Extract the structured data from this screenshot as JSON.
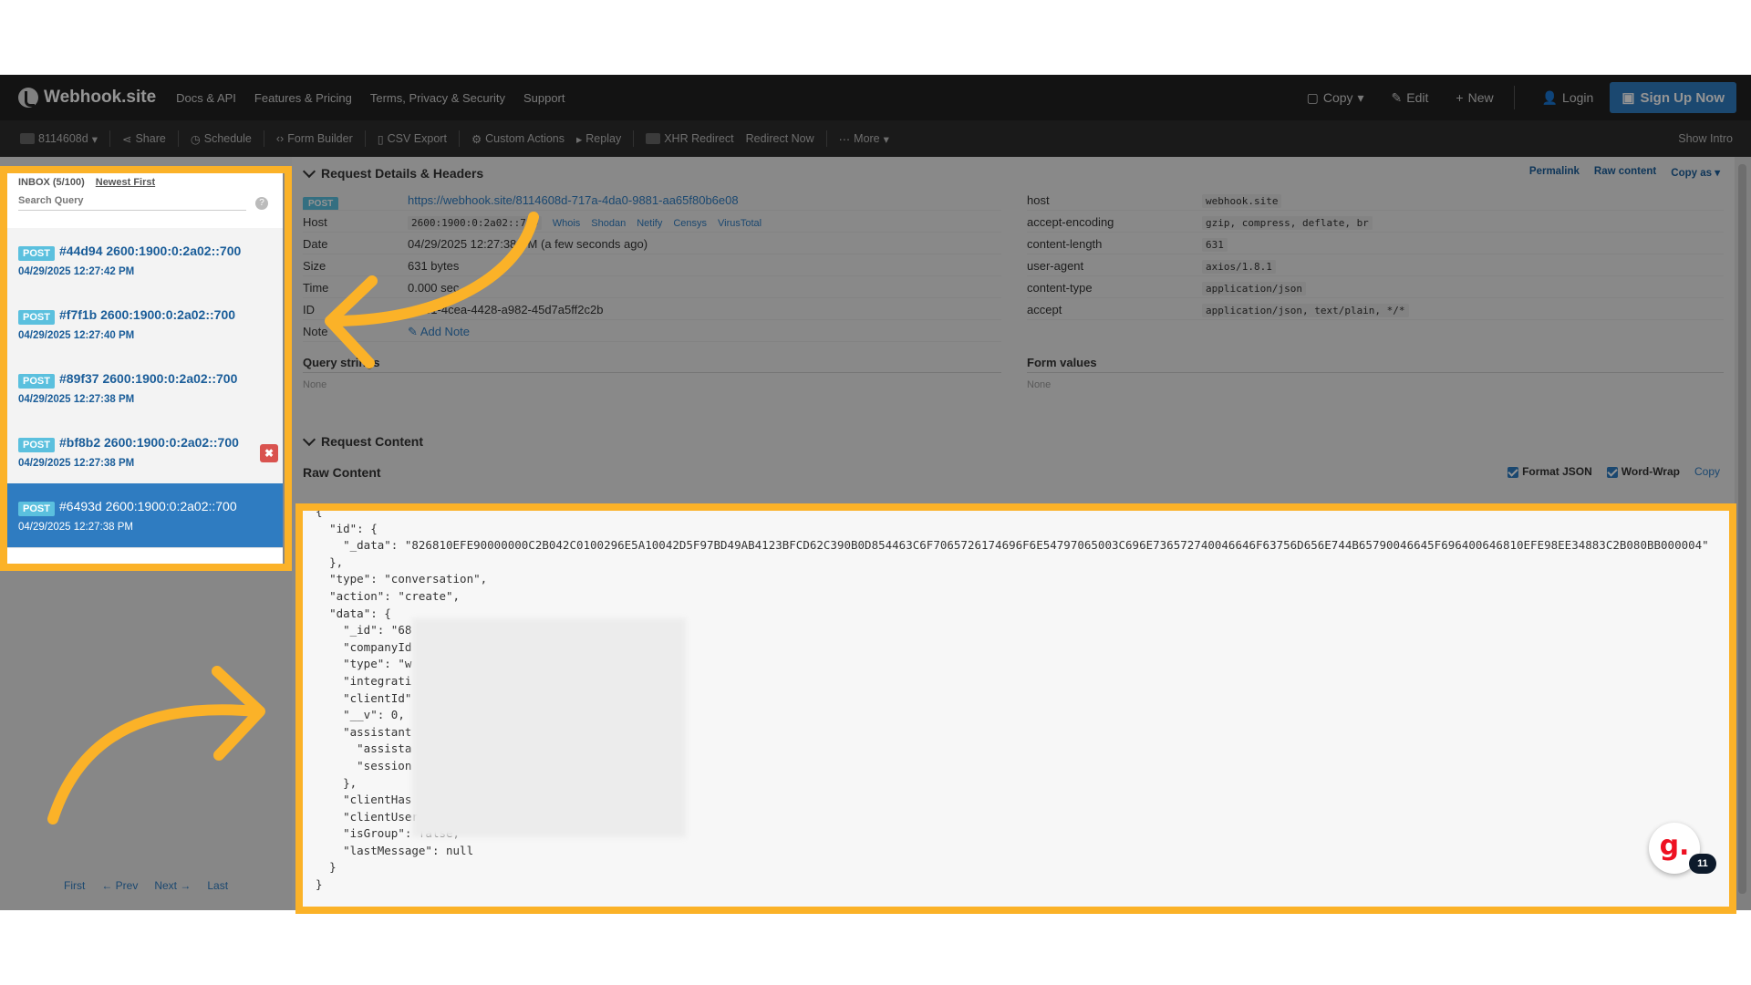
{
  "navbar": {
    "brand": "Webhook.site",
    "links": [
      "Docs & API",
      "Features & Pricing",
      "Terms, Privacy & Security",
      "Support"
    ],
    "copy": "Copy",
    "edit": "Edit",
    "new": "New",
    "login": "Login",
    "signup": "Sign Up Now"
  },
  "toolbar": {
    "token": "8114608d",
    "share": "Share",
    "schedule": "Schedule",
    "form_builder": "Form Builder",
    "csv_export": "CSV Export",
    "custom_actions": "Custom Actions",
    "replay": "Replay",
    "xhr_redirect": "XHR Redirect",
    "redirect_now": "Redirect Now",
    "more": "More",
    "show_intro": "Show Intro"
  },
  "inbox": {
    "title": "INBOX (5/100)",
    "sort": "Newest First",
    "search_placeholder": "Search Query",
    "requests": [
      {
        "method": "POST",
        "title": "#44d94 2600:1900:0:2a02::700",
        "date": "04/29/2025 12:27:42 PM"
      },
      {
        "method": "POST",
        "title": "#f7f1b 2600:1900:0:2a02::700",
        "date": "04/29/2025 12:27:40 PM"
      },
      {
        "method": "POST",
        "title": "#89f37 2600:1900:0:2a02::700",
        "date": "04/29/2025 12:27:38 PM"
      },
      {
        "method": "POST",
        "title": "#bf8b2 2600:1900:0:2a02::700",
        "date": "04/29/2025 12:27:38 PM"
      },
      {
        "method": "POST",
        "title": "#6493d 2600:1900:0:2a02::700",
        "date": "04/29/2025 12:27:38 PM"
      }
    ],
    "pager": {
      "first": "First",
      "prev": "← Prev",
      "next": "Next →",
      "last": "Last"
    }
  },
  "details": {
    "header": "Request Details & Headers",
    "permalink": "Permalink",
    "raw_content_link": "Raw content",
    "copy_as": "Copy as",
    "method": "POST",
    "url": "https://webhook.site/8114608d-717a-4da0-9881-aa65f80b6e08",
    "host_label": "Host",
    "host_value": "2600:1900:0:2a02::700",
    "host_links": [
      "Whois",
      "Shodan",
      "Netify",
      "Censys",
      "VirusTotal"
    ],
    "date_label": "Date",
    "date_value": "04/29/2025 12:27:38 PM (a few seconds ago)",
    "size_label": "Size",
    "size_value": "631 bytes",
    "time_label": "Time",
    "time_value": "0.000 sec",
    "id_label": "ID",
    "id_value": "...d61-4cea-4428-a982-45d7a5ff2c2b",
    "note_label": "Note",
    "add_note": "Add Note",
    "query_strings": "Query strings",
    "form_values": "Form values",
    "none": "None",
    "headers": [
      {
        "k": "host",
        "v": "webhook.site"
      },
      {
        "k": "accept-encoding",
        "v": "gzip, compress, deflate, br"
      },
      {
        "k": "content-length",
        "v": "631"
      },
      {
        "k": "user-agent",
        "v": "axios/1.8.1"
      },
      {
        "k": "content-type",
        "v": "application/json"
      },
      {
        "k": "accept",
        "v": "application/json, text/plain, */*"
      }
    ]
  },
  "content": {
    "header": "Request Content",
    "raw_title": "Raw Content",
    "format_json": "Format JSON",
    "word_wrap": "Word-Wrap",
    "copy": "Copy",
    "json_text": "{\n  \"id\": {\n    \"_data\": \"826810EFE90000000C2B042C0100296E5A10042D5F97BD49AB4123BFCD62C390B0D854463C6F7065726174696F6E54797065003C696E736572740046646F63756D656E744B65790046645F696400646810EFE98EE34883C2B080BB000004\"\n  },\n  \"type\": \"conversation\",\n  \"action\": \"create\",\n  \"data\": {\n    \"_id\": \"68\n    \"companyId\n    \"type\": \"w\n    \"integrati\n    \"clientId\"\n    \"__v\": 0,\n    \"assistant\n      \"assista\n      \"session\n    },\n    \"clientHas\n    \"clientUserId\": null,\n    \"isGroup\": false,\n    \"lastMessage\": null\n  }\n}"
  },
  "grammarly": {
    "letter": "g.",
    "count": "11"
  },
  "colors": {
    "highlight": "#fbb228",
    "accent": "#2f7cc1",
    "navbar": "#222222"
  }
}
